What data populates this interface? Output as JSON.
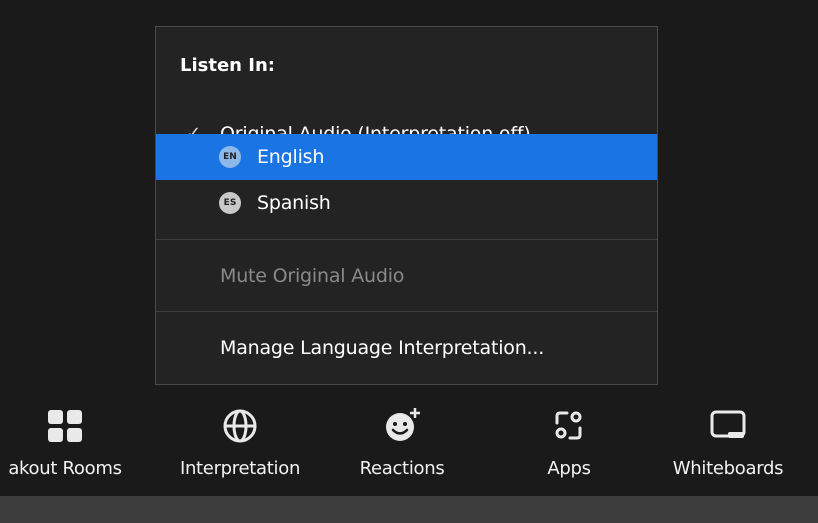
{
  "menu": {
    "header": "Listen In:",
    "items": [
      {
        "label": "Original Audio (Interpretation off)",
        "checked": true
      },
      {
        "label": "English",
        "badge": "EN",
        "badge_color": "#8fb8ea",
        "selected": true
      },
      {
        "label": "Spanish",
        "badge": "ES",
        "badge_color": "#c8c8c8"
      }
    ],
    "mute_label": "Mute Original Audio",
    "manage_label": "Manage Language Interpretation...",
    "check_glyph": "✓"
  },
  "toolbar": {
    "items": [
      {
        "label": "akout Rooms",
        "icon": "breakout-rooms-icon"
      },
      {
        "label": "Interpretation",
        "icon": "globe-icon"
      },
      {
        "label": "Reactions",
        "icon": "reactions-icon"
      },
      {
        "label": "Apps",
        "icon": "apps-icon"
      },
      {
        "label": "Whiteboards",
        "icon": "whiteboard-icon"
      }
    ]
  },
  "colors": {
    "background": "#1a1a1a",
    "menu": "#232323",
    "selected": "#1b74e4",
    "bottom_bar": "#3c3c3c"
  }
}
